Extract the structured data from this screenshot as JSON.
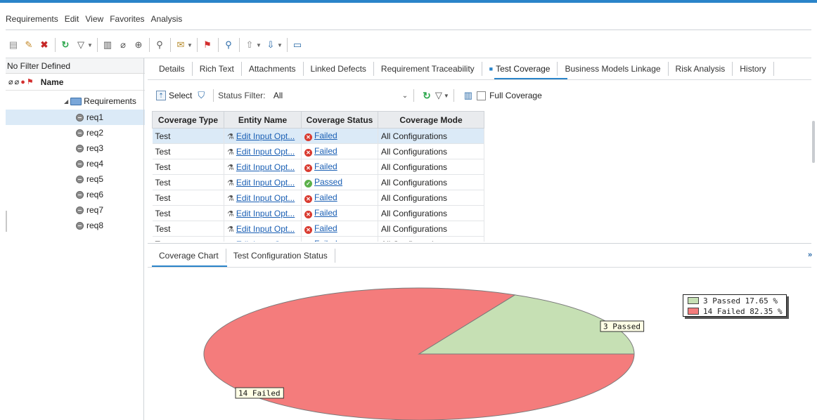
{
  "menu": [
    "Requirements",
    "Edit",
    "View",
    "Favorites",
    "Analysis"
  ],
  "toolbar_icons": [
    "new-folder-icon",
    "new-requirement-icon",
    "delete-icon",
    "refresh-icon",
    "filter-icon",
    "columns-icon",
    "attachment-icon",
    "zoom-icon",
    "pin-icon",
    "mail-icon",
    "flag-icon",
    "find-icon",
    "move-up-icon",
    "move-down-icon",
    "comment-icon"
  ],
  "left": {
    "filter_text": "No Filter Defined",
    "column_name": "Name",
    "root": "Requirements",
    "items": [
      "req1",
      "req2",
      "req3",
      "req4",
      "req5",
      "req6",
      "req7",
      "req8"
    ],
    "selected": "req1"
  },
  "tabs": [
    "Details",
    "Rich Text",
    "Attachments",
    "Linked Defects",
    "Requirement Traceability",
    "Test Coverage",
    "Business Models Linkage",
    "Risk Analysis",
    "History"
  ],
  "active_tab": "Test Coverage",
  "subtoolbar": {
    "select_label": "Select",
    "status_filter_label": "Status Filter:",
    "status_filter_value": "All",
    "full_coverage_label": "Full Coverage"
  },
  "grid": {
    "columns": [
      "Coverage Type",
      "Entity Name",
      "Coverage Status",
      "Coverage Mode"
    ],
    "rows": [
      {
        "type": "Test",
        "entity": "Edit Input Opt...",
        "status": "Failed",
        "mode": "All Configurations"
      },
      {
        "type": "Test",
        "entity": "Edit Input Opt...",
        "status": "Failed",
        "mode": "All Configurations"
      },
      {
        "type": "Test",
        "entity": "Edit Input Opt...",
        "status": "Failed",
        "mode": "All Configurations"
      },
      {
        "type": "Test",
        "entity": "Edit Input Opt...",
        "status": "Passed",
        "mode": "All Configurations"
      },
      {
        "type": "Test",
        "entity": "Edit Input Opt...",
        "status": "Failed",
        "mode": "All Configurations"
      },
      {
        "type": "Test",
        "entity": "Edit Input Opt...",
        "status": "Failed",
        "mode": "All Configurations"
      },
      {
        "type": "Test",
        "entity": "Edit Input Opt...",
        "status": "Failed",
        "mode": "All Configurations"
      },
      {
        "type": "Test",
        "entity": "Edit Input Opt...",
        "status": "Failed",
        "mode": "All Configurations"
      }
    ]
  },
  "lower_tabs": [
    "Coverage Chart",
    "Test Configuration Status"
  ],
  "chart_data": {
    "type": "pie",
    "categories": [
      "Passed",
      "Failed"
    ],
    "values": [
      3,
      14
    ],
    "labels": [
      "3 Passed",
      "14 Failed"
    ],
    "legend": [
      "3 Passed  17.65 %",
      "14 Failed  82.35 %"
    ],
    "colors": [
      "#c6e0b4",
      "#f47c7c"
    ],
    "legend_position": "top-right"
  }
}
